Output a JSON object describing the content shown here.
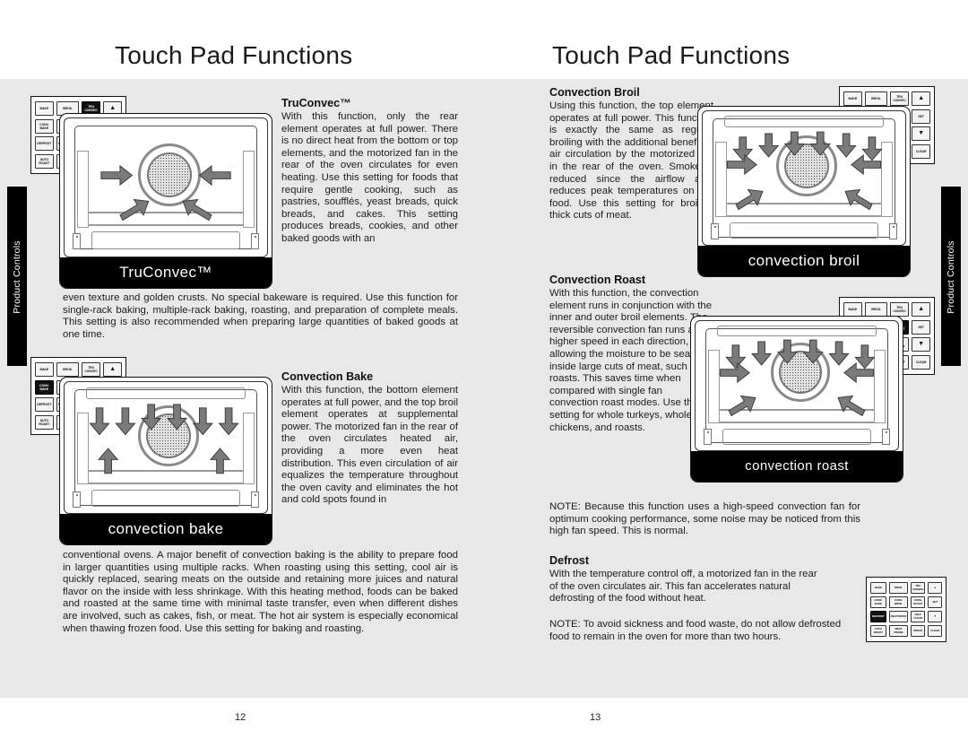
{
  "document": {
    "tab_label_left": "Product Controls",
    "tab_label_right": "Product Controls"
  },
  "left_page": {
    "heading": "Touch Pad Functions",
    "folio": "12",
    "sections": [
      {
        "title": "TruConvec™",
        "text": "With this function, only the rear element operates at full power. There is no direct heat from the bottom or top elements, and the motorized fan in the rear of the oven circulates for even heating. Use this setting for foods that require gentle cooking, such as pastries, soufflés, yeast breads, quick breads, and cakes. This setting produces breads, cookies, and other baked goods with an",
        "continued": "even texture and golden crusts. No special bakeware is required. Use this function for single-rack baking, multiple-rack baking, roasting, and preparation of complete meals. This setting is also recommended when preparing large quantities of baked goods at one time."
      },
      {
        "title": "Convection Bake",
        "text": "With this function, the bottom element operates at full power, and the top broil element operates at supplemental power. The motorized fan in the rear of the oven circulates heated air, providing a more even heat distribution. This even circulation of air equalizes the temperature throughout the oven cavity and eliminates the hot and cold spots found in",
        "continued": "conventional ovens. A major benefit of convection baking is the ability to prepare food in larger quantities using multiple racks. When roasting using this setting, cool air is quickly replaced, searing meats on the outside and retaining more juices and natural flavor on the inside with less shrinkage. With this heating method, foods can be baked and roasted at the same time with minimal taste transfer, even when different dishes are involved, such as cakes, fish, or meat. The hot air system is especially economical when thawing frozen food. Use this setting for baking and roasting."
      }
    ],
    "illustrations": [
      {
        "caption": "TruConvec™"
      },
      {
        "caption": "convection bake"
      }
    ]
  },
  "right_page": {
    "heading": "Touch Pad Functions",
    "folio": "13",
    "sections": [
      {
        "title": "Convection Broil",
        "text": "Using this function, the top element operates at full power. This function is exactly the same as regular broiling with the additional benefit of air circulation by the motorized fan in the rear of the oven. Smoke is reduced since the airflow also reduces peak temperatures on the food. Use this setting for broiling thick cuts of meat."
      },
      {
        "title": "Convection Roast",
        "text": "With this function, the convection element runs in conjunction with the inner and outer broil elements. The reversible convection fan runs at a higher speed in each direction, allowing the moisture to be sealed inside large cuts of meat, such as roasts. This saves time when compared with single fan convection roast modes. Use this setting for whole turkeys, whole chickens, and roasts."
      }
    ],
    "note_1": "NOTE:  Because this function uses a high-speed convection fan for optimum cooking performance, some noise may be noticed from this high fan speed. This is normal.",
    "defrost": {
      "title": "Defrost",
      "text": "With the temperature control off, a motorized fan in the rear of the oven circulates air. This fan accelerates natural defrosting of the food without heat.",
      "note": "NOTE: To avoid sickness and food waste, do not allow defrosted food to remain in the oven for more than two hours."
    },
    "illustrations": [
      {
        "caption": "convection broil"
      },
      {
        "caption": "convection roast"
      }
    ]
  },
  "control_panel": {
    "keys": [
      "BAKE",
      "BROIL",
      "TRU\nCONVEC",
      "▲",
      "CONV.\nBAKE",
      "CONV.\nBROIL",
      "CONV.\nROAST",
      "SET",
      "DEFROST",
      "DEHYDRATE",
      "SELF\nCLEAN",
      "▼",
      "AUTO\nROAST",
      "MEAT\nPROBE",
      "PROOF",
      "CLEAR"
    ],
    "panels": [
      {
        "id": "panel-truconvec",
        "active_key": "TRU\nCONVEC"
      },
      {
        "id": "panel-convection-bake",
        "active_key": "CONV.\nBAKE"
      },
      {
        "id": "panel-convection-broil",
        "active_key": "CONV.\nBROIL"
      },
      {
        "id": "panel-convection-roast",
        "active_key": "CONV.\nROAST"
      },
      {
        "id": "panel-defrost",
        "active_key": "DEFROST"
      }
    ],
    "defrost_panel_keys": [
      "BAKE",
      "BROIL",
      "TRU\nCONVEC",
      "▲",
      "CONV.\nBAKE",
      "CONV.\nBROIL",
      "CONV.\nROAST",
      "SET",
      "DEFROST",
      "DEHYDRATE",
      "SELF\nCLEAN",
      "▼",
      "AUTO\nROAST",
      "MEAT\nPROBE",
      "PROOF",
      "CLEAR"
    ]
  },
  "colors": {
    "band": "#e8e8e8",
    "tab": "#000000",
    "text": "#1d1d1d",
    "caption_bar": "#000000"
  }
}
